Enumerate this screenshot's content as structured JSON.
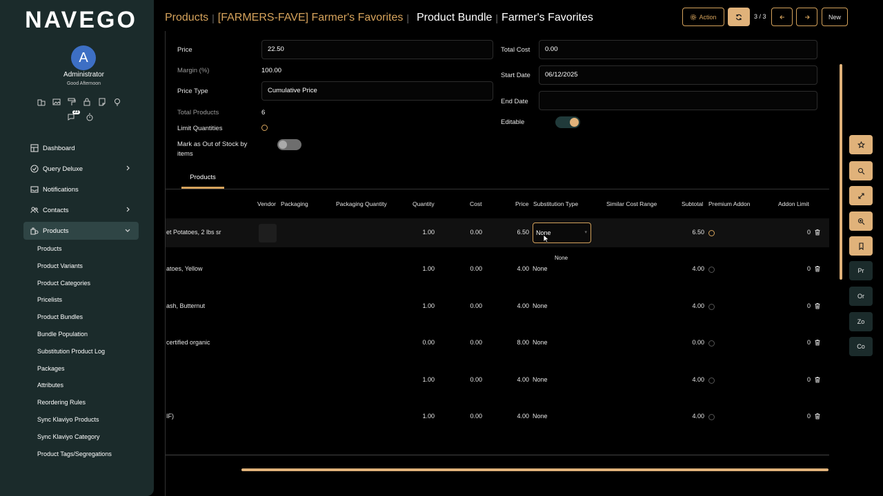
{
  "app": {
    "logo": "NAVEGO"
  },
  "user": {
    "initial": "A",
    "name": "Administrator",
    "greeting": "Good Afternoon",
    "chat_badge": "23"
  },
  "sidebar": {
    "items": [
      {
        "label": "Dashboard",
        "icon": "dashboard-icon"
      },
      {
        "label": "Query Deluxe",
        "icon": "check-circle-icon"
      },
      {
        "label": "Notifications",
        "icon": "inbox-icon"
      },
      {
        "label": "Contacts",
        "icon": "users-icon"
      },
      {
        "label": "Products",
        "icon": "products-icon"
      }
    ],
    "sub_items": [
      "Products",
      "Product Variants",
      "Product Categories",
      "Pricelists",
      "Product Bundles",
      "Bundle Population",
      "Substitution Product Log",
      "Packages",
      "Attributes",
      "Reordering Rules",
      "Sync Klaviyo Products",
      "Sync Klaviyo Category",
      "Product Tags/Segregations"
    ]
  },
  "header": {
    "crumb_1": "Products",
    "crumb_2": "[FARMERS-FAVE] Farmer's Favorites",
    "crumb_3": "Product Bundle",
    "crumb_4": "Farmer's Favorites",
    "action_label": "Action",
    "pager": "3 / 3",
    "new_label": "New"
  },
  "form": {
    "price_label": "Price",
    "price_value": "22.50",
    "margin_label": "Margin (%)",
    "margin_value": "100.00",
    "price_type_label": "Price Type",
    "price_type_value": "Cumulative Price",
    "total_products_label": "Total Products",
    "total_products_value": "6",
    "limit_quantities_label": "Limit Quantities",
    "mark_oos_label_1": "Mark as Out of Stock by",
    "mark_oos_label_2": "items",
    "total_cost_label": "Total Cost",
    "total_cost_value": "0.00",
    "start_date_label": "Start Date",
    "start_date_value": "06/12/2025",
    "end_date_label": "End Date",
    "end_date_value": "",
    "editable_label": "Editable"
  },
  "tabs": {
    "products": "Products"
  },
  "table": {
    "headers": {
      "vendor": "Vendor",
      "packaging": "Packaging",
      "packaging_qty": "Packaging Quantity",
      "quantity": "Quantity",
      "cost": "Cost",
      "price": "Price",
      "substitution_type": "Substitution Type",
      "similar_cost_range": "Similar Cost Range",
      "subtotal": "Subtotal",
      "premium_addon": "Premium Addon",
      "addon_limit": "Addon Limit"
    },
    "rows": [
      {
        "product": "et Potatoes, 2 lbs sr",
        "quantity": "1.00",
        "cost": "0.00",
        "price": "6.50",
        "substitution": "None",
        "subtotal": "6.50",
        "addon_limit": "0"
      },
      {
        "product": "atoes, Yellow",
        "quantity": "1.00",
        "cost": "0.00",
        "price": "4.00",
        "substitution": "None",
        "subtotal": "4.00",
        "addon_limit": "0"
      },
      {
        "product": "ash, Butternut",
        "quantity": "1.00",
        "cost": "0.00",
        "price": "4.00",
        "substitution": "None",
        "subtotal": "4.00",
        "addon_limit": "0"
      },
      {
        "product": "certified organic",
        "quantity": "0.00",
        "cost": "0.00",
        "price": "8.00",
        "substitution": "None",
        "subtotal": "0.00",
        "addon_limit": "0"
      },
      {
        "product": "",
        "quantity": "1.00",
        "cost": "0.00",
        "price": "4.00",
        "substitution": "None",
        "subtotal": "4.00",
        "addon_limit": "0"
      },
      {
        "product": "IF)",
        "quantity": "1.00",
        "cost": "0.00",
        "price": "4.00",
        "substitution": "None",
        "subtotal": "4.00",
        "addon_limit": "0"
      }
    ],
    "dropdown_option": "None"
  },
  "rail": {
    "dark_buttons": [
      "Pr",
      "Or",
      "Zo",
      "Co"
    ]
  },
  "colors": {
    "accent": "#d6a35c",
    "sidebar_bg": "#1b2b2b",
    "background": "#000000"
  }
}
